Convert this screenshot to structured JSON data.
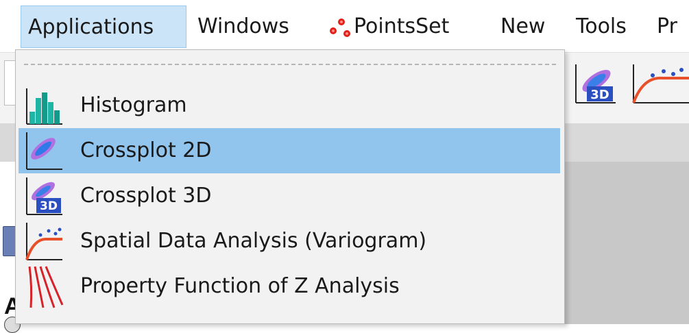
{
  "menubar": {
    "items": [
      {
        "label": "Applications",
        "active": true
      },
      {
        "label": "Windows"
      },
      {
        "label": "PointsSet",
        "icon": "points-set-icon"
      },
      {
        "label": "New"
      },
      {
        "label": "Tools"
      },
      {
        "label": "Pr"
      }
    ]
  },
  "applications_menu": {
    "items": [
      {
        "label": "Histogram",
        "icon": "histogram-icon"
      },
      {
        "label": "Crossplot 2D",
        "icon": "crossplot-2d-icon",
        "highlighted": true
      },
      {
        "label": "Crossplot 3D",
        "icon": "crossplot-3d-icon"
      },
      {
        "label": "Spatial Data Analysis (Variogram)",
        "icon": "variogram-icon"
      },
      {
        "label": "Property Function of Z Analysis",
        "icon": "property-function-z-icon"
      }
    ]
  },
  "background": {
    "partial_letter": "A"
  },
  "colors": {
    "menu_active_bg": "#cce4f7",
    "menu_highlight_bg": "#91c5ee",
    "dropdown_bg": "#f2f2f2"
  }
}
